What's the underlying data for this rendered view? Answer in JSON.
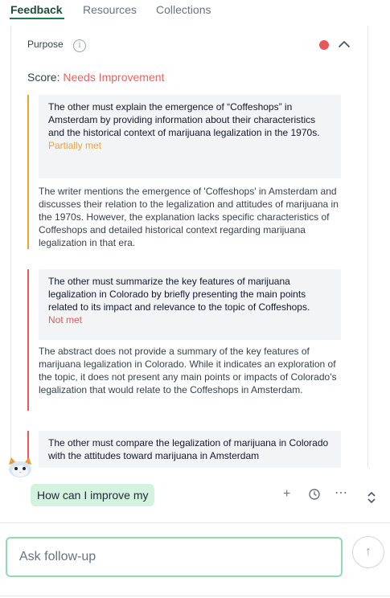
{
  "tabs": [
    {
      "label": "Feedback"
    },
    {
      "label": "Resources"
    },
    {
      "label": "Collections"
    }
  ],
  "section": {
    "title": "Purpose",
    "info_icon": "info-icon",
    "status_color": "#e5595a",
    "score_label": "Score:",
    "score_value": "Needs Improvement",
    "score_color": "#e46564"
  },
  "criteria": [
    {
      "text": "The other must explain the emergence of “Coffeshops” in Amsterdam by providing information about their characteristics and the historical context of marijuana legalization in the 1970s.",
      "status": "Partially met",
      "status_color": "#f0a32b",
      "explanation": "The writer mentions the emergence of 'Coffeshops' in Amsterdam and discusses their relation to the legalization and attitudes of marijuana in the 1970s. However, the explanation lacks specific characteristics of Coffeshops and detailed historical context regarding marijuana legalization in that era."
    },
    {
      "text": "The other must summarize the key features of marijuana legalization in Colorado by briefly presenting the main points related to its impact and relevance to the topic of Coffeshops.",
      "status": "Not met",
      "status_color": "#e5595a",
      "explanation": "The abstract does not provide a summary of the key features of marijuana legalization in Colorado. While it indicates an exploration of the topic, it does not present any main points or impacts of Colorado's legalization that would relate to the Coffeshops in Amsterdam."
    },
    {
      "text": "The other must compare the legalization of marijuana in Colorado with the attitudes toward marijuana in Amsterdam",
      "status_color": "#e5595a"
    }
  ],
  "chat": {
    "suggestion": "How can I improve my",
    "input_placeholder": "Ask follow-up",
    "send_icon": "arrow-up-icon"
  }
}
